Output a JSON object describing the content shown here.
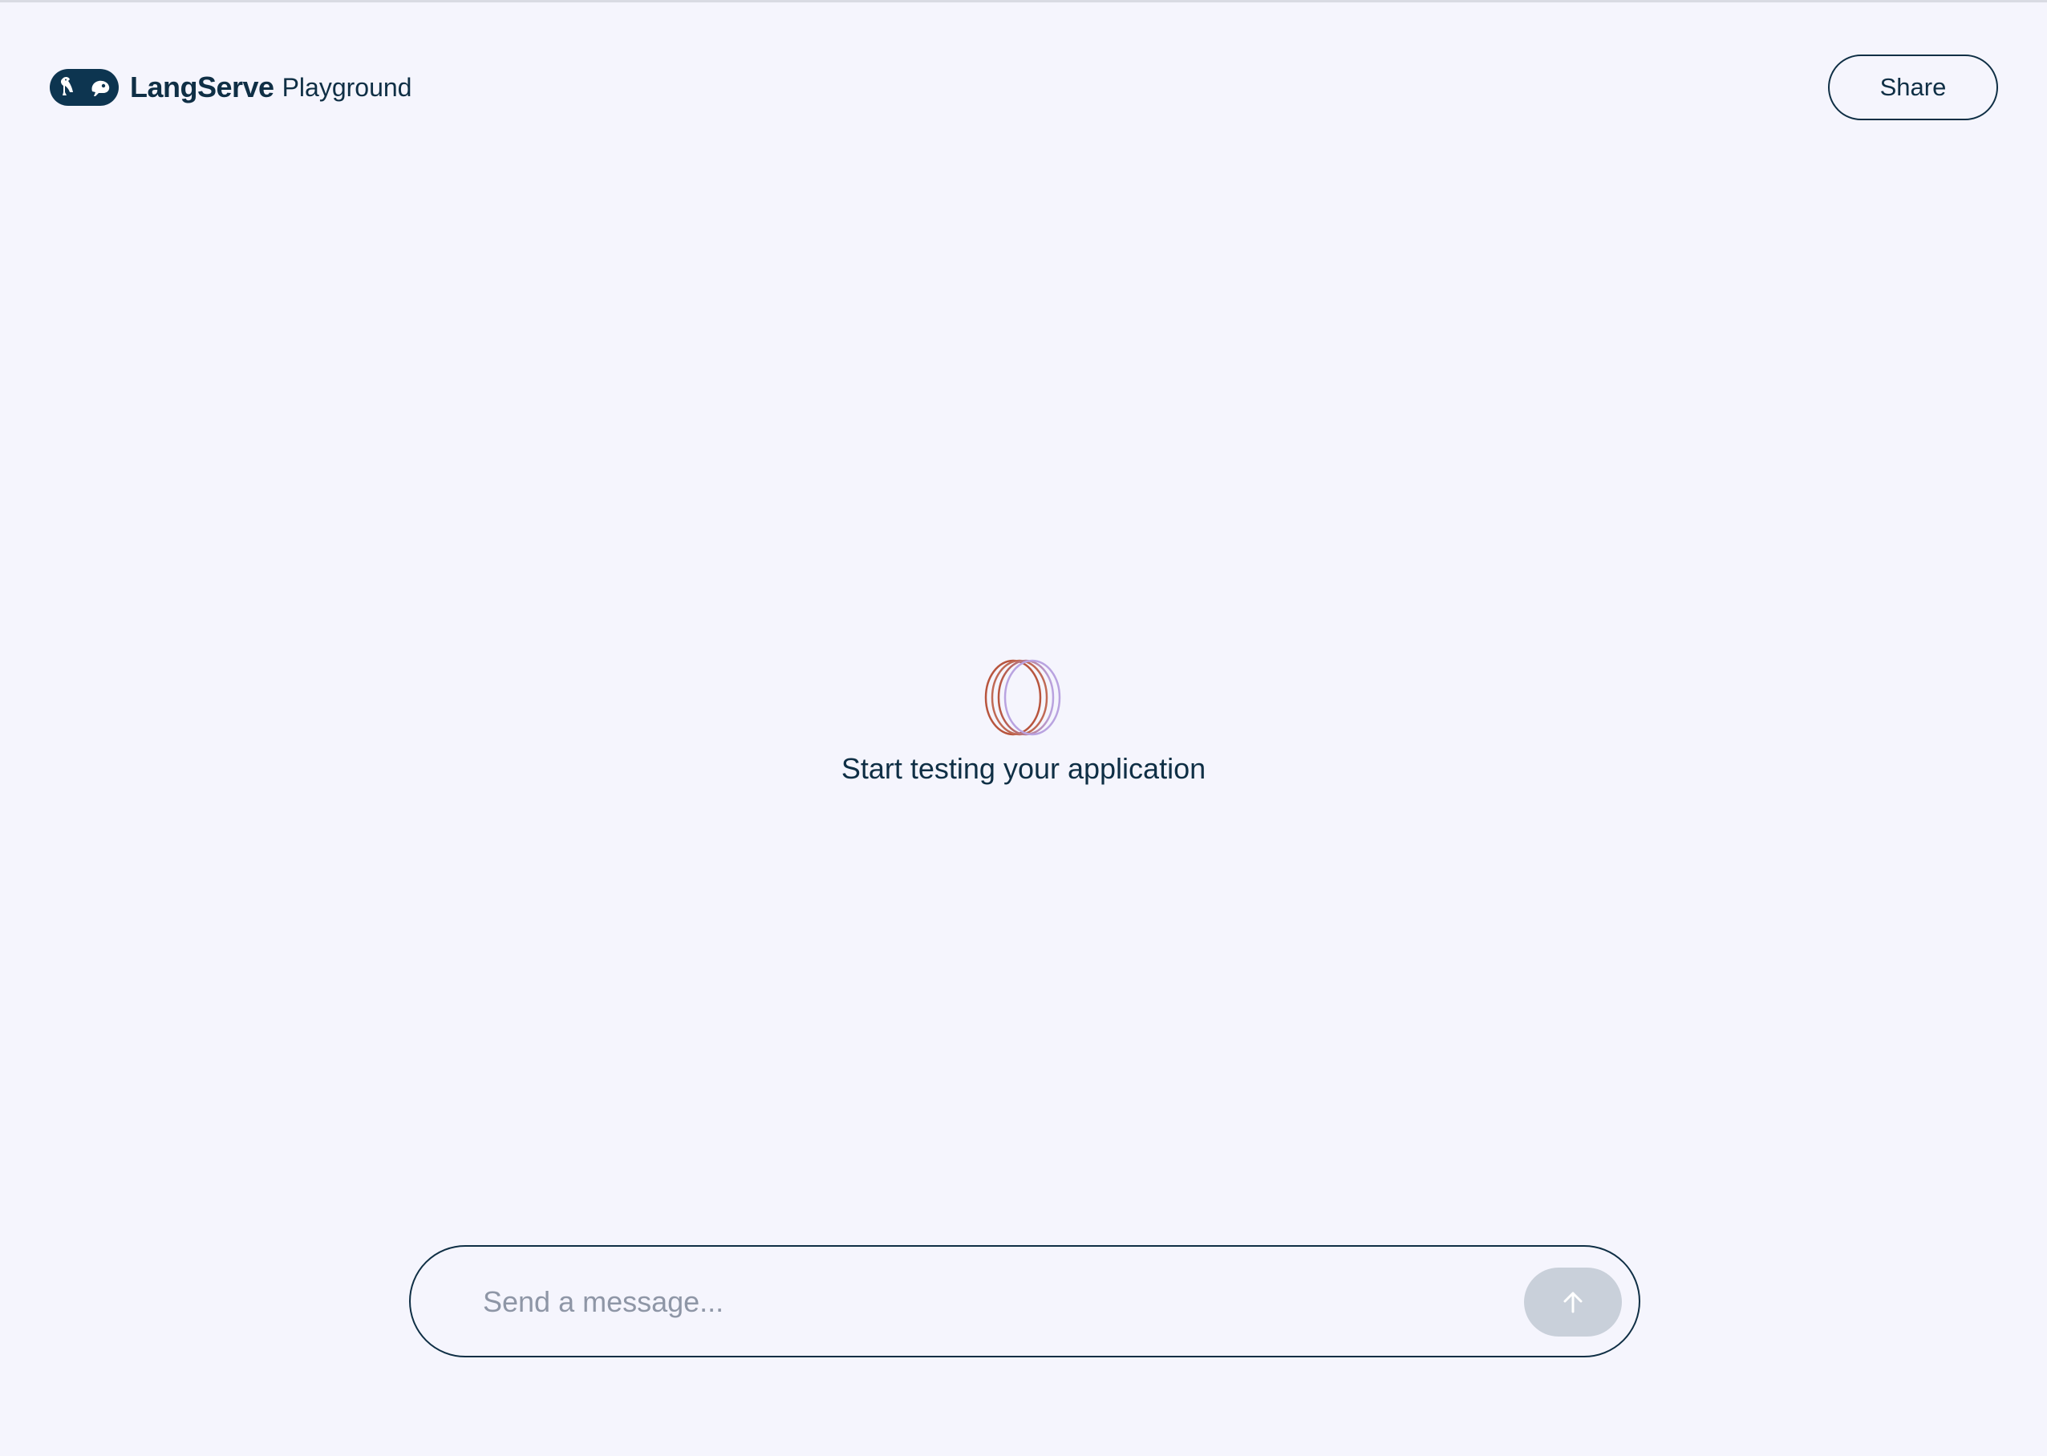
{
  "app": {
    "brand_name": "LangServe",
    "brand_suffix": "Playground"
  },
  "header": {
    "share_label": "Share"
  },
  "empty_state": {
    "title": "Start testing your application",
    "icon": "overlapping-rings-icon"
  },
  "composer": {
    "placeholder": "Send a message...",
    "value": "",
    "send_icon": "arrow-up-icon"
  },
  "colors": {
    "background": "#f5f5fd",
    "text_primary": "#0f2f45",
    "logo_badge": "#0d3550",
    "send_button_disabled": "#c9d0da",
    "placeholder": "#8e96a6",
    "ring_warm": "#b8553e",
    "ring_cool": "#b9a3e0"
  }
}
